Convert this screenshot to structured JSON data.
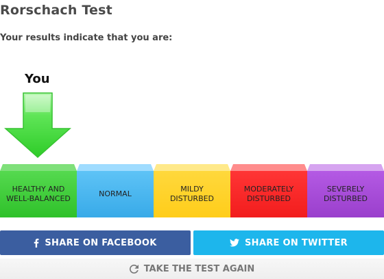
{
  "page": {
    "title": "Rorschach Test",
    "subtitle": "Your results indicate that you are:"
  },
  "indicator": {
    "label": "You",
    "selected_index": 0,
    "color": "#3fd13a"
  },
  "scale": {
    "segments": [
      {
        "line1": "HEALTHY AND",
        "line2": "WELL-BALANCED",
        "color": "#3fd13a"
      },
      {
        "line1": "NORMAL",
        "line2": "",
        "color": "#4ab8f0"
      },
      {
        "line1": "MILDY",
        "line2": "DISTURBED",
        "color": "#ffd21f"
      },
      {
        "line1": "MODERATELY",
        "line2": "DISTURBED",
        "color": "#f42424"
      },
      {
        "line1": "SEVERELY",
        "line2": "DISTURBED",
        "color": "#a94cd9"
      }
    ]
  },
  "actions": {
    "facebook": {
      "label": "SHARE ON FACEBOOK",
      "icon": "facebook-icon",
      "color": "#3b5ea0"
    },
    "twitter": {
      "label": "SHARE ON TWITTER",
      "icon": "twitter-icon",
      "color": "#1db6ec"
    },
    "retake": {
      "label": "TAKE THE TEST AGAIN",
      "icon": "refresh-icon"
    }
  }
}
